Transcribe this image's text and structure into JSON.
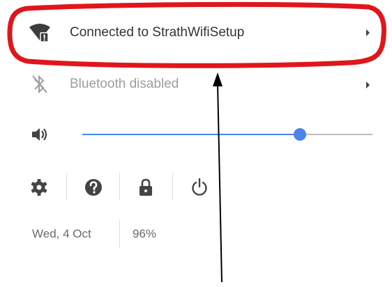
{
  "network": {
    "label": "Connected to StrathWifiSetup",
    "icon": "wifi-warning-icon"
  },
  "bluetooth": {
    "label": "Bluetooth disabled",
    "icon": "bluetooth-disabled-icon"
  },
  "volume": {
    "icon": "speaker-icon",
    "level": 0.75
  },
  "actions": [
    {
      "name": "settings",
      "icon": "gear-icon"
    },
    {
      "name": "help",
      "icon": "help-icon"
    },
    {
      "name": "lock",
      "icon": "lock-icon"
    },
    {
      "name": "power",
      "icon": "power-icon"
    }
  ],
  "status": {
    "date": "Wed, 4 Oct",
    "battery": "96%"
  },
  "colors": {
    "highlight": "#e0161b",
    "slider": "#4a86e8",
    "text": "#333333",
    "muted": "#9e9e9e"
  }
}
